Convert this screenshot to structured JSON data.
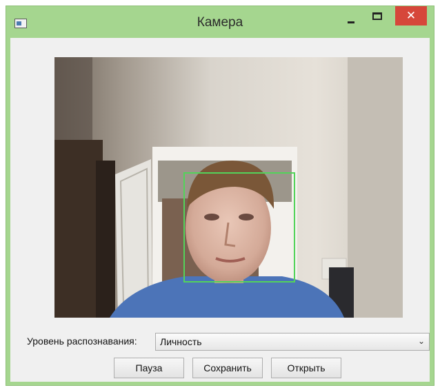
{
  "window": {
    "title": "Камера",
    "close_glyph": "✕"
  },
  "controls": {
    "recognition_label": "Уровень распознавания:",
    "recognition_value": "Личность",
    "dropdown_glyph": "⌄"
  },
  "buttons": {
    "pause": "Пауза",
    "save": "Сохранить",
    "open": "Открыть"
  },
  "colors": {
    "titlebar": "#a5d68f",
    "close_button": "#d6473a",
    "face_box": "#53d35a"
  },
  "icons": [
    "app-window-icon",
    "minimize-icon",
    "maximize-icon",
    "close-icon",
    "chevron-down-icon"
  ]
}
